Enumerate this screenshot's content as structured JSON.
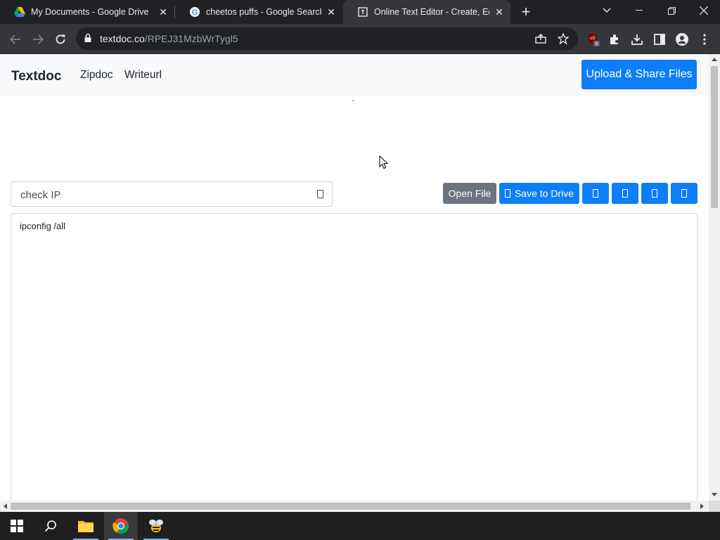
{
  "browser": {
    "tabs": [
      {
        "title": "My Documents - Google Drive",
        "favicon": "google-drive-icon",
        "active": false
      },
      {
        "title": "cheetos puffs - Google Search",
        "favicon": "google-icon",
        "active": false
      },
      {
        "title": "Online Text Editor - Create, Edit,",
        "favicon": "textdoc-icon",
        "active": true
      }
    ],
    "url_domain": "textdoc.co",
    "url_path": "/RPEJ31MzbWrTygl5",
    "extension_badge": "6"
  },
  "site": {
    "brand": "Textdoc",
    "nav_links": [
      "Zipdoc",
      "Writeurl"
    ],
    "upload_button": "Upload & Share Files"
  },
  "editor": {
    "doc_title": "check IP",
    "open_file_label": "Open File",
    "save_drive_label": "Save to Drive",
    "content": "ipconfig /all"
  },
  "colors": {
    "primary": "#0d7ef8",
    "secondary": "#6c757d",
    "browser_dark": "#202124",
    "toolbar": "#35363a"
  }
}
